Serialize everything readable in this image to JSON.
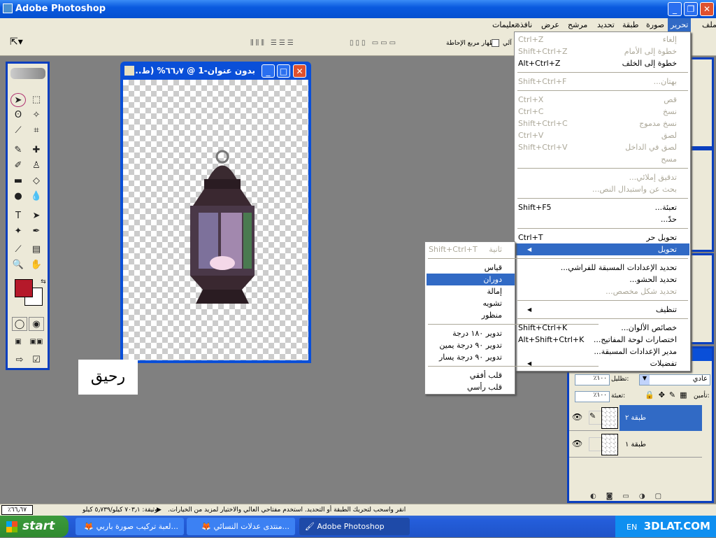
{
  "app": {
    "title": "Adobe Photoshop"
  },
  "menubar": [
    {
      "label": "ملف",
      "active": false
    },
    {
      "label": "تحرير",
      "active": true
    },
    {
      "label": "صورة",
      "active": false
    },
    {
      "label": "طبقة",
      "active": false
    },
    {
      "label": "تحديد",
      "active": false
    },
    {
      "label": "مرشح",
      "active": false
    },
    {
      "label": "عرض",
      "active": false
    },
    {
      "label": "نافذة",
      "active": false
    },
    {
      "label": "تعليمات",
      "active": false
    }
  ],
  "options": {
    "show_bounding_box": "إظهار مربع الإحاطة",
    "auto_select_partial": "آلي",
    "show_bounding_box_checked": false
  },
  "document": {
    "title": "بدون عنوان-1 @ ٦٦٫٧% (ط..."
  },
  "text_layer_content": "رحيق",
  "edit_menu": [
    {
      "label": "إلغاء",
      "shortcut": "Ctrl+Z",
      "disabled": true
    },
    {
      "label": "خطوة إلى الأمام",
      "shortcut": "Shift+Ctrl+Z",
      "disabled": true
    },
    {
      "label": "خطوة إلى الخلف",
      "shortcut": "Alt+Ctrl+Z",
      "disabled": false,
      "sep": true
    },
    {
      "label": "بهتان...",
      "shortcut": "Shift+Ctrl+F",
      "disabled": true,
      "sep": true
    },
    {
      "label": "قص",
      "shortcut": "Ctrl+X",
      "disabled": true
    },
    {
      "label": "نسخ",
      "shortcut": "Ctrl+C",
      "disabled": true
    },
    {
      "label": "نسخ مدموج",
      "shortcut": "Shift+Ctrl+C",
      "disabled": true
    },
    {
      "label": "لصق",
      "shortcut": "Ctrl+V",
      "disabled": true
    },
    {
      "label": "لصق في الداخل",
      "shortcut": "Shift+Ctrl+V",
      "disabled": true
    },
    {
      "label": "مسح",
      "shortcut": "",
      "disabled": true,
      "sep": true
    },
    {
      "label": "تدقيق إملائي...",
      "shortcut": "",
      "disabled": true
    },
    {
      "label": "بحث عن واستبدال النص...",
      "shortcut": "",
      "disabled": true,
      "sep": true
    },
    {
      "label": "تعبئة...",
      "shortcut": "Shift+F5",
      "disabled": false
    },
    {
      "label": "حدّ...",
      "shortcut": "",
      "disabled": false,
      "sep": true
    },
    {
      "label": "تحويل حر",
      "shortcut": "Ctrl+T",
      "disabled": false
    },
    {
      "label": "تحويل",
      "shortcut": "",
      "disabled": false,
      "highlighted": true,
      "submenu": true,
      "sep": true
    },
    {
      "label": "تحديد الإعدادات المسبقة للفراشي...",
      "shortcut": "",
      "disabled": false
    },
    {
      "label": "تحديد الحشو...",
      "shortcut": "",
      "disabled": false
    },
    {
      "label": "تحديد شكل مخصص...",
      "shortcut": "",
      "disabled": true,
      "sep": true
    },
    {
      "label": "تنظيف",
      "shortcut": "",
      "disabled": false,
      "submenu": true,
      "sep": true
    },
    {
      "label": "خصائص الألوان...",
      "shortcut": "Shift+Ctrl+K",
      "disabled": false
    },
    {
      "label": "اختصارات لوحة المفاتيح...",
      "shortcut": "Alt+Shift+Ctrl+K",
      "disabled": false
    },
    {
      "label": "مدير الإعدادات المسبقة...",
      "shortcut": "",
      "disabled": false
    },
    {
      "label": "تفضيلات",
      "shortcut": "",
      "disabled": false,
      "submenu": true
    }
  ],
  "transform_submenu": [
    {
      "label": "ثانية",
      "shortcut": "Shift+Ctrl+T",
      "disabled": true,
      "sep": true
    },
    {
      "label": "قياس",
      "shortcut": ""
    },
    {
      "label": "دوران",
      "shortcut": "",
      "highlighted": true
    },
    {
      "label": "إمالة",
      "shortcut": ""
    },
    {
      "label": "تشويه",
      "shortcut": ""
    },
    {
      "label": "منظور",
      "shortcut": "",
      "sep": true
    },
    {
      "label": "تدوير ١٨٠ درجة",
      "shortcut": ""
    },
    {
      "label": "تدوير ٩٠ درجة يمين",
      "shortcut": ""
    },
    {
      "label": "تدوير ٩٠ درجة يسار",
      "shortcut": "",
      "sep": true
    },
    {
      "label": "قلب أفقي",
      "shortcut": ""
    },
    {
      "label": "قلب رأسي",
      "shortcut": ""
    }
  ],
  "layers": {
    "blend_mode": "عادي",
    "opacity_label": "تظليل:",
    "opacity": "٪١٠٠",
    "lock_label": "تأمين:",
    "fill_label": "تعبئة:",
    "fill": "٪١٠٠",
    "items": [
      {
        "name": "طبقة ٢",
        "selected": true,
        "visible": true
      },
      {
        "name": "طبقة ١",
        "selected": false,
        "visible": true
      }
    ]
  },
  "statusbar": {
    "zoom": "٪٦٦٫٦٧",
    "doc_info": "وثيقة: ٧٠٣٫١ كيلو/٥٫٧٣٩ كيلو",
    "hint": "انقر واسحب لتحريك الطبقة أو التحديد. استخدم مفتاحي العالي والاختيار لمزيد من الخيارات."
  },
  "taskbar": {
    "start": "start",
    "tasks": [
      {
        "label": "...لعبة تركيب صورة باربي",
        "active": false
      },
      {
        "label": "...منتدى عدلات النسائي",
        "active": false
      },
      {
        "label": "Adobe Photoshop",
        "active": true
      }
    ],
    "lang": "EN",
    "watermark": "3DLAT.COM"
  },
  "colors": {
    "foreground": "#b5192a",
    "background": "#ffffff",
    "accent": "#316ac5"
  }
}
